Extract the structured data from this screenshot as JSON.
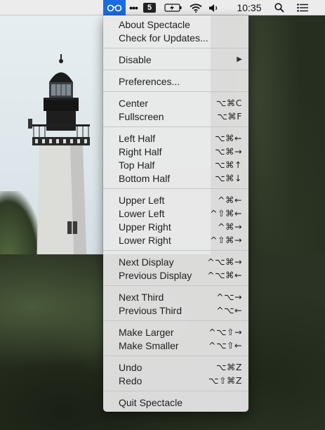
{
  "menubar": {
    "badge": "5",
    "clock": "10:35"
  },
  "menu": {
    "groups": [
      [
        {
          "label": "About Spectacle",
          "shortcut": ""
        },
        {
          "label": "Check for Updates...",
          "shortcut": ""
        }
      ],
      [
        {
          "label": "Disable",
          "shortcut": "",
          "submenu": true
        }
      ],
      [
        {
          "label": "Preferences...",
          "shortcut": ""
        }
      ],
      [
        {
          "label": "Center",
          "shortcut": "⌥⌘C"
        },
        {
          "label": "Fullscreen",
          "shortcut": "⌥⌘F"
        }
      ],
      [
        {
          "label": "Left Half",
          "shortcut": "⌥⌘←"
        },
        {
          "label": "Right Half",
          "shortcut": "⌥⌘→"
        },
        {
          "label": "Top Half",
          "shortcut": "⌥⌘↑"
        },
        {
          "label": "Bottom Half",
          "shortcut": "⌥⌘↓"
        }
      ],
      [
        {
          "label": "Upper Left",
          "shortcut": "^⌘←"
        },
        {
          "label": "Lower Left",
          "shortcut": "^⇧⌘←"
        },
        {
          "label": "Upper Right",
          "shortcut": "^⌘→"
        },
        {
          "label": "Lower Right",
          "shortcut": "^⇧⌘→"
        }
      ],
      [
        {
          "label": "Next Display",
          "shortcut": "^⌥⌘→"
        },
        {
          "label": "Previous Display",
          "shortcut": "^⌥⌘←"
        }
      ],
      [
        {
          "label": "Next Third",
          "shortcut": "^⌥→"
        },
        {
          "label": "Previous Third",
          "shortcut": "^⌥←"
        }
      ],
      [
        {
          "label": "Make Larger",
          "shortcut": "^⌥⇧→"
        },
        {
          "label": "Make Smaller",
          "shortcut": "^⌥⇧←"
        }
      ],
      [
        {
          "label": "Undo",
          "shortcut": "⌥⌘Z"
        },
        {
          "label": "Redo",
          "shortcut": "⌥⇧⌘Z"
        }
      ],
      [
        {
          "label": "Quit Spectacle",
          "shortcut": ""
        }
      ]
    ]
  },
  "icons": {
    "spectacle": "spectacle-glasses-icon",
    "dots": "ellipsis-icon",
    "battery": "battery-charging-icon",
    "wifi": "wifi-icon",
    "volume": "volume-icon",
    "search": "spotlight-search-icon",
    "notification": "notification-center-icon",
    "submenu": "chevron-right-icon"
  },
  "colors": {
    "menubar_highlight": "#1a6be0",
    "menu_background": "#e8e8e8"
  }
}
